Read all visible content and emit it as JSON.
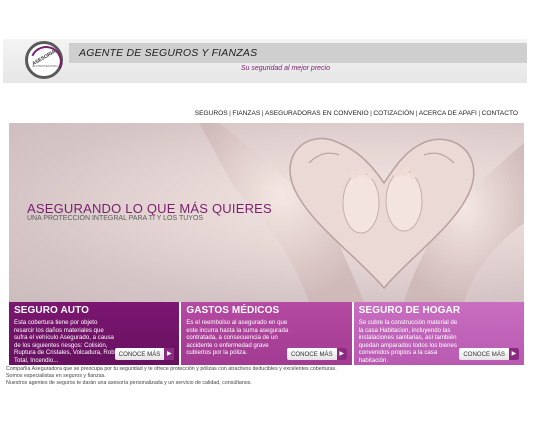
{
  "header": {
    "logo_text": "ASESORIA",
    "logo_subtext": "EN PROTECCION",
    "title": "AGENTE DE SEGUROS Y FIANZAS",
    "tagline": "Su seguridad al mejor precio"
  },
  "nav": {
    "items": [
      {
        "label": "SEGUROS"
      },
      {
        "label": "FIANZAS"
      },
      {
        "label": "ASEGURADORAS EN CONVENIO"
      },
      {
        "label": "COTIZACIÓN"
      },
      {
        "label": "ACERCA DE APAFI"
      },
      {
        "label": "CONTACTO"
      }
    ],
    "separator": "|"
  },
  "hero": {
    "title": "ASEGURANDO LO QUE MÁS QUIERES",
    "subtitle": "UNA PROTECCIÓN INTEGRAL PARA TI Y LOS TUYOS"
  },
  "cards": [
    {
      "title": "SEGURO AUTO",
      "text": "Esta cobertura tiene por objeto resarcir los daños materiales que sufra el vehículo Asegurado, a causa de los siguientes riesgos: Colisión, Ruptura de Cristales, Volcadura, Robo Total, Incendio...",
      "button": "CONOCE MÁS",
      "color": "#7c1670"
    },
    {
      "title": "GASTOS MÉDICOS",
      "text": "Es el reembolso al asegurado en que este incurra hasta la suma asegurada contratada, a consecuencia de un accidente o enfermedad grave cubiertos por la póliza.",
      "button": "CONOCE MÁS",
      "color": "#b54aa2"
    },
    {
      "title": "SEGURO DE HOGAR",
      "text": "Se cubre la construcción material de la casa Habitacion, incluyendo las instalaciones sanitarias, así también quedan amparados todos los bienes convenidos propios a la casa habitación.",
      "button": "CONOCE MÁS",
      "color": "#c96ec1"
    }
  ],
  "footer": {
    "lines": [
      "Compañía Aseguradora que se preocupa por tu seguridad y te ofrece protección y  pólizas con atractivos deducibles y excelentes coberturas.",
      "Somos especialistas en seguros y fianzas.",
      "Nuestros agentes de seguros te darán una asesoría personalizada y un servicio de calidad, consúltanos."
    ]
  },
  "icons": {
    "button_arrow": "chevron-right-icon",
    "logo": "asesoria-logo-icon"
  },
  "colors": {
    "brand": "#7a1e6e",
    "header_bar": "#cfcfcf"
  }
}
